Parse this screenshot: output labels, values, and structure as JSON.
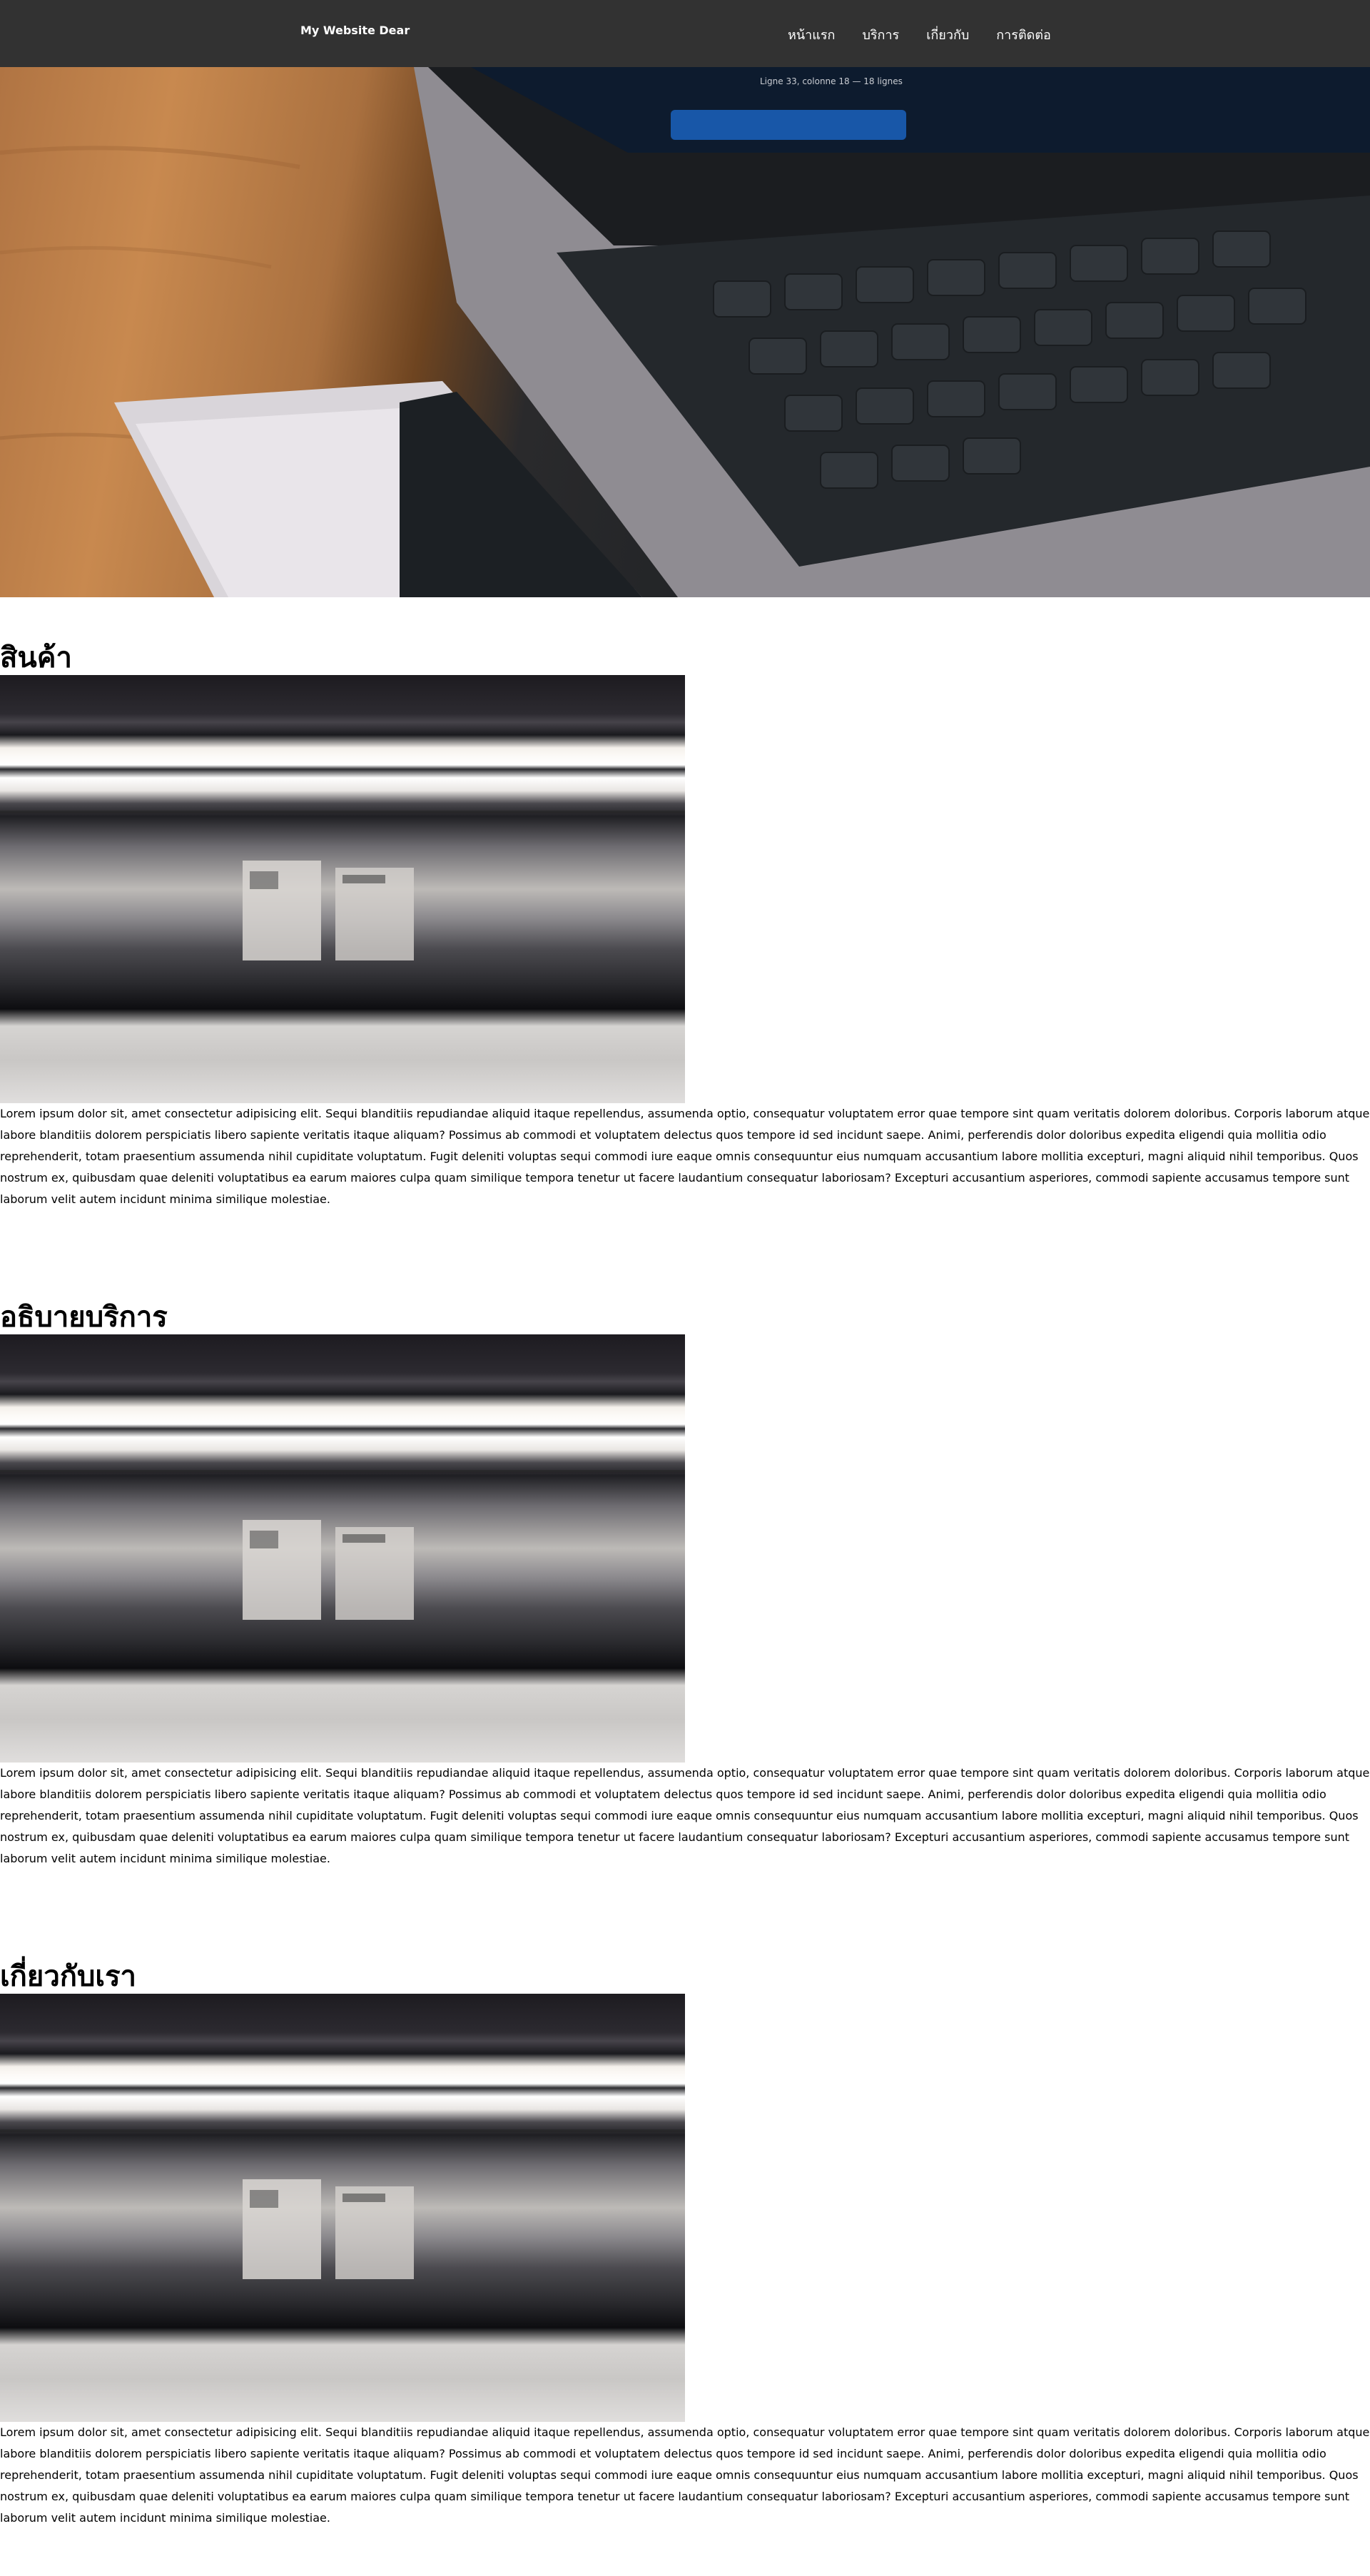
{
  "navbar": {
    "brand": "My Website Dear",
    "links": [
      "หน้าแรก",
      "บริการ",
      "เกี่ยวกับ",
      "การติดต่อ"
    ]
  },
  "hero": {
    "image_description": "laptop-and-phone-photo",
    "screen_caption": "Ligne 33, colonne 18 — 18 lignes"
  },
  "sections": [
    {
      "title": "สินค้า",
      "body": "Lorem ipsum dolor sit, amet consectetur adipisicing elit. Sequi blanditiis repudiandae aliquid itaque repellendus, assumenda optio, consequatur voluptatem error quae tempore sint quam veritatis dolorem doloribus. Corporis laborum atque labore blanditiis dolorem perspiciatis libero sapiente veritatis itaque aliquam? Possimus ab commodi et voluptatem delectus quos tempore id sed incidunt saepe. Animi, perferendis dolor doloribus expedita eligendi quia mollitia odio reprehenderit, totam praesentium assumenda nihil cupiditate voluptatum. Fugit deleniti voluptas sequi commodi iure eaque omnis consequuntur eius numquam accusantium labore mollitia excepturi, magni aliquid nihil temporibus. Quos nostrum ex, quibusdam quae deleniti voluptatibus ea earum maiores culpa quam similique tempora tenetur ut facere laudantium consequatur laboriosam? Excepturi accusantium asperiores, commodi sapiente accusamus tempore sunt laborum velit autem incidunt minima similique molestiae."
    },
    {
      "title": "อธิบายบริการ",
      "body": "Lorem ipsum dolor sit, amet consectetur adipisicing elit. Sequi blanditiis repudiandae aliquid itaque repellendus, assumenda optio, consequatur voluptatem error quae tempore sint quam veritatis dolorem doloribus. Corporis laborum atque labore blanditiis dolorem perspiciatis libero sapiente veritatis itaque aliquam? Possimus ab commodi et voluptatem delectus quos tempore id sed incidunt saepe. Animi, perferendis dolor doloribus expedita eligendi quia mollitia odio reprehenderit, totam praesentium assumenda nihil cupiditate voluptatum. Fugit deleniti voluptas sequi commodi iure eaque omnis consequuntur eius numquam accusantium labore mollitia excepturi, magni aliquid nihil temporibus. Quos nostrum ex, quibusdam quae deleniti voluptatibus ea earum maiores culpa quam similique tempora tenetur ut facere laudantium consequatur laboriosam? Excepturi accusantium asperiores, commodi sapiente accusamus tempore sunt laborum velit autem incidunt minima similique molestiae."
    },
    {
      "title": "เกี่ยวกับเรา",
      "body": "Lorem ipsum dolor sit, amet consectetur adipisicing elit. Sequi blanditiis repudiandae aliquid itaque repellendus, assumenda optio, consequatur voluptatem error quae tempore sint quam veritatis dolorem doloribus. Corporis laborum atque labore blanditiis dolorem perspiciatis libero sapiente veritatis itaque aliquam? Possimus ab commodi et voluptatem delectus quos tempore id sed incidunt saepe. Animi, perferendis dolor doloribus expedita eligendi quia mollitia odio reprehenderit, totam praesentium assumenda nihil cupiditate voluptatum. Fugit deleniti voluptas sequi commodi iure eaque omnis consequuntur eius numquam accusantium labore mollitia excepturi, magni aliquid nihil temporibus. Quos nostrum ex, quibusdam quae deleniti voluptatibus ea earum maiores culpa quam similique tempora tenetur ut facere laudantium consequatur laboriosam? Excepturi accusantium asperiores, commodi sapiente accusamus tempore sunt laborum velit autem incidunt minima similique molestiae."
    }
  ],
  "colors": {
    "navbar_bg": "#323232",
    "nav_text": "#ffffff",
    "page_bg": "#ffffff",
    "text": "#000000"
  }
}
